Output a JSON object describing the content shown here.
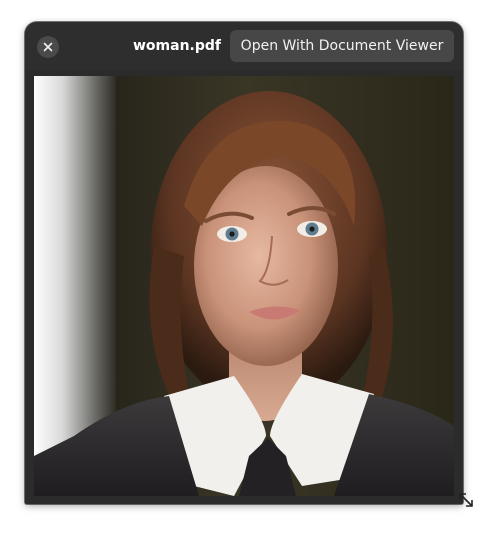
{
  "window": {
    "title": "woman.pdf",
    "close_icon": "close-icon",
    "open_button_label": "Open With Document Viewer"
  },
  "document": {
    "page_image": "portrait-photo",
    "description_icon": "photo-image"
  },
  "colors": {
    "headerbar": "#2e2e2e",
    "window_bg": "#2b2b2b",
    "button_bg": "#474747",
    "close_bg": "#4a4a4a",
    "text": "#ffffff"
  }
}
